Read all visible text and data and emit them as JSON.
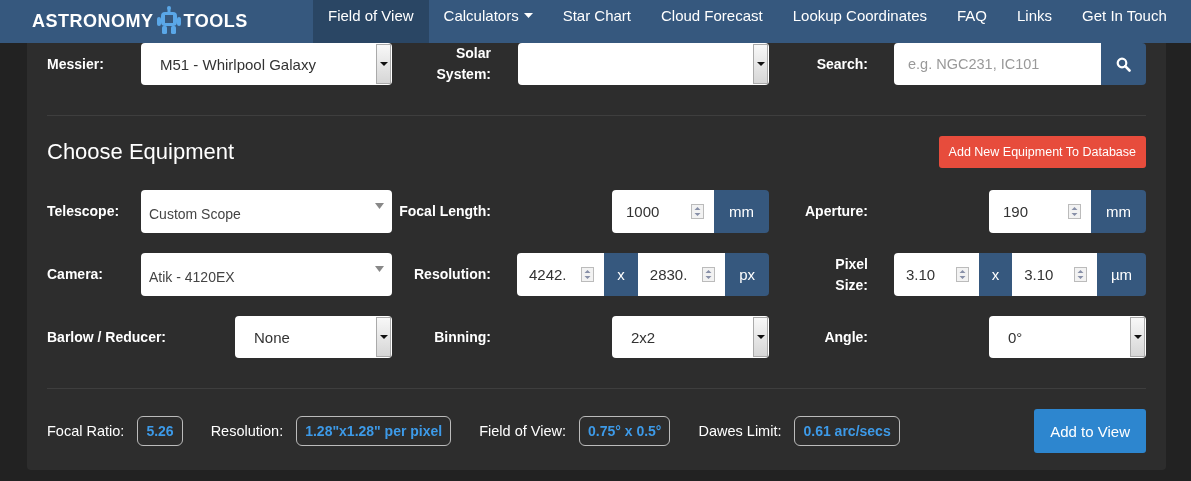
{
  "navbar": {
    "logo_left": "ASTRONOMY",
    "logo_right": "TOOLS",
    "items": [
      {
        "label": "Field of View",
        "selected": true,
        "dropdown": false
      },
      {
        "label": "Calculators",
        "selected": false,
        "dropdown": true
      },
      {
        "label": "Star Chart",
        "selected": false,
        "dropdown": false
      },
      {
        "label": "Cloud Forecast",
        "selected": false,
        "dropdown": false
      },
      {
        "label": "Lookup Coordinates",
        "selected": false,
        "dropdown": false
      },
      {
        "label": "FAQ",
        "selected": false,
        "dropdown": false
      },
      {
        "label": "Links",
        "selected": false,
        "dropdown": false
      },
      {
        "label": "Get In Touch",
        "selected": false,
        "dropdown": false
      }
    ]
  },
  "target_row": [
    {
      "label": "Messier:",
      "kind": "select",
      "value": "M51 - Whirlpool Galaxy"
    },
    {
      "label": "Solar\nSystem:",
      "kind": "select"
    },
    {
      "label": "Search:",
      "kind": "search",
      "placeholder": "e.g. NGC231, IC101"
    }
  ],
  "equipment": {
    "title": "Choose Equipment",
    "add_button": "Add New Equipment To Database",
    "rows": [
      [
        {
          "label": "Telescope:",
          "kind": "dropdown",
          "value": "Custom Scope"
        },
        {
          "label": "Focal Length:",
          "kind": "number",
          "inputs": [
            "1000"
          ],
          "unit": "mm"
        },
        {
          "label": "Aperture:",
          "kind": "number",
          "inputs": [
            "190"
          ],
          "unit": "mm"
        }
      ],
      [
        {
          "label": "Camera:",
          "kind": "dropdown",
          "value": "Atik - 4120EX"
        },
        {
          "label": "Resolution:",
          "kind": "number",
          "inputs": [
            "4242.",
            "2830."
          ],
          "separator": "x",
          "unit": "px"
        },
        {
          "label": "Pixel\nSize:",
          "kind": "number",
          "inputs": [
            "3.10",
            "3.10"
          ],
          "separator": "x",
          "unit": "µm"
        }
      ],
      [
        {
          "label": "Barlow / Reducer:",
          "kind": "select",
          "value": "None"
        },
        {
          "label": "Binning:",
          "kind": "select",
          "value": "2x2"
        },
        {
          "label": "Angle:",
          "kind": "select",
          "value": "0°"
        }
      ]
    ]
  },
  "results": {
    "stats": [
      {
        "label": "Focal Ratio:",
        "value": "5.26"
      },
      {
        "label": "Resolution:",
        "value": "1.28\"x1.28\" per pixel"
      },
      {
        "label": "Field of View:",
        "value": "0.75° x 0.5°"
      },
      {
        "label": "Dawes Limit:",
        "value": "0.61 arc/secs"
      }
    ],
    "button": "Add to View"
  }
}
